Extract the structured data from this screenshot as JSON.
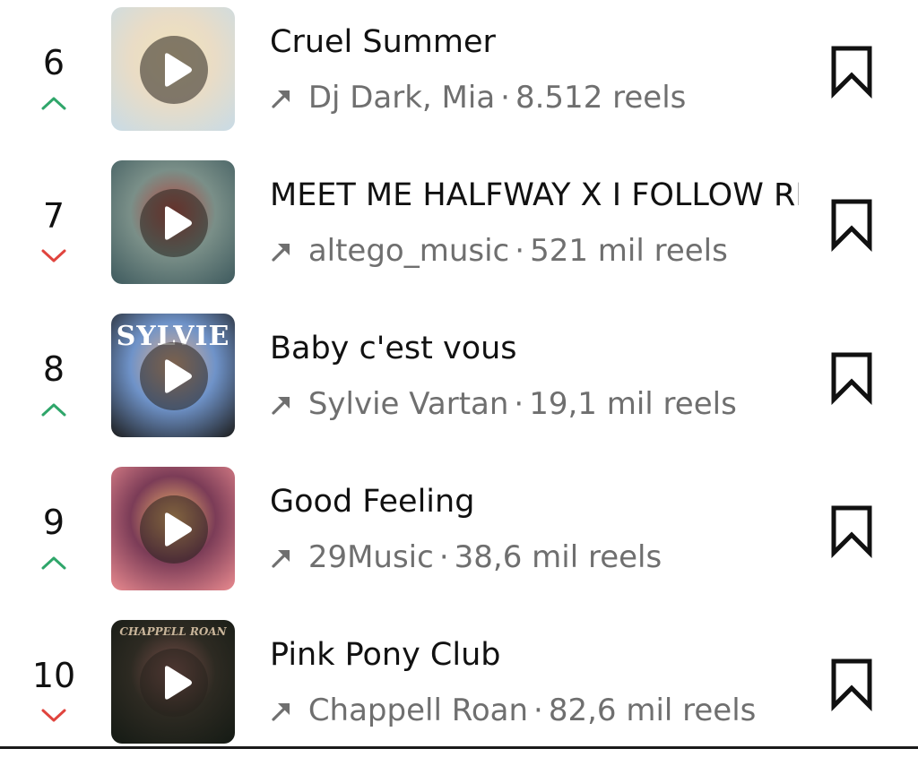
{
  "songs": [
    {
      "rank": "6",
      "trend": "up",
      "title": "Cruel Summer",
      "artist": "Dj Dark, Mia",
      "separator": "·",
      "reels": "8.512 reels",
      "cover_text": "",
      "colors": {
        "c1": "#c8dbe6",
        "c2": "#e9dcc6",
        "c3": "#f2e3b8"
      }
    },
    {
      "rank": "7",
      "trend": "down",
      "title": "MEET ME HALFWAY X I FOLLOW RI...",
      "artist": "altego_music",
      "separator": "·",
      "reels": "521 mil reels",
      "cover_text": "",
      "colors": {
        "c1": "#3e5a5e",
        "c2": "#7a8f88",
        "c3": "#b2473f"
      }
    },
    {
      "rank": "8",
      "trend": "up",
      "title": "Baby c'est vous",
      "artist": "Sylvie Vartan",
      "separator": "·",
      "reels": "19,1 mil reels",
      "cover_text": "SYLVIE",
      "colors": {
        "c1": "#1c1c1c",
        "c2": "#6f93c9",
        "c3": "#e6b088"
      }
    },
    {
      "rank": "9",
      "trend": "up",
      "title": "Good Feeling",
      "artist": "29Music",
      "separator": "·",
      "reels": "38,6 mil reels",
      "cover_text": "",
      "colors": {
        "c1": "#e98a8f",
        "c2": "#7b3c57",
        "c3": "#f1b56a"
      }
    },
    {
      "rank": "10",
      "trend": "down",
      "title": "Pink Pony Club",
      "artist": "Chappell Roan",
      "separator": "·",
      "reels": "82,6 mil reels",
      "cover_text": "CHAPPELL ROAN",
      "colors": {
        "c1": "#141a14",
        "c2": "#2d2a22",
        "c3": "#7a4f4a"
      }
    }
  ],
  "icons": {
    "trend_up": "chevron-up-icon",
    "trend_down": "chevron-down-icon",
    "play": "play-icon",
    "artist_link": "arrow-up-right-icon",
    "save": "bookmark-icon"
  },
  "colors": {
    "trend_up": "#2fa66a",
    "trend_down": "#e0443e",
    "text_primary": "#111111",
    "text_secondary": "#6f6f6f"
  }
}
